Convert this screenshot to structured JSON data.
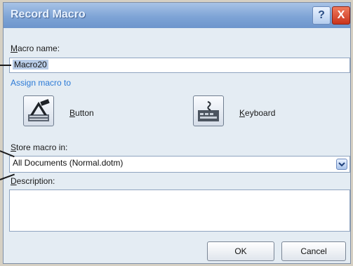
{
  "dialog": {
    "title": "Record Macro",
    "help_glyph": "?",
    "close_glyph": "X"
  },
  "macro_name": {
    "label_mnemonic": "M",
    "label_rest": "acro name:",
    "value": "Macro20"
  },
  "assign": {
    "heading": "Assign macro to",
    "button": {
      "label_mnemonic": "B",
      "label_rest": "utton",
      "icon": "hammer-icon"
    },
    "keyboard": {
      "label_mnemonic": "K",
      "label_rest": "eyboard",
      "icon": "keyboard-icon"
    }
  },
  "store": {
    "label_mnemonic": "S",
    "label_rest": "tore macro in:",
    "selected": "All Documents (Normal.dotm)"
  },
  "description": {
    "label_mnemonic": "D",
    "label_rest": "escription:",
    "value": ""
  },
  "buttons": {
    "ok": "OK",
    "cancel": "Cancel"
  },
  "colors": {
    "title_bar": "#7ea4d6",
    "dialog_bg": "#e4ecf3",
    "heading_blue": "#2c7ad6"
  }
}
